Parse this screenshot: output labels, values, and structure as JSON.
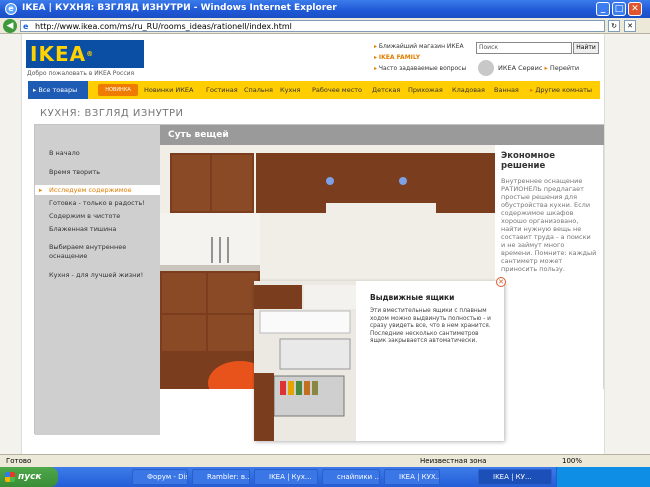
{
  "window": {
    "title": "IKEA | КУХНЯ: ВЗГЛЯД ИЗНУТРИ - Windows Internet Explorer",
    "url": "http://www.ikea.com/ms/ru_RU/rooms_ideas/rationell/index.html"
  },
  "header": {
    "logo": "IKEA",
    "welcome": "Добро пожаловать в ИКЕА Россия",
    "links": [
      "Ближайший магазин ИКЕА",
      "IKEA FAMILY",
      "Часто задаваемые вопросы"
    ],
    "search_placeholder": "Поиск",
    "search_button": "Найти",
    "service": "ИКЕА Сервис",
    "goto": "Перейти"
  },
  "menu": {
    "all": "Все товары",
    "badge": "НОВИНКА",
    "items": [
      "Новинки ИКЕА",
      "Гостиная",
      "Спальня",
      "Кухня",
      "Рабочее место",
      "Детская",
      "Прихожая",
      "Кладовая",
      "Ванная",
      "Другие комнаты"
    ]
  },
  "headline": "КУХНЯ: ВЗГЛЯД ИЗНУТРИ",
  "left_nav": [
    "В начало",
    "Время творить",
    "Исследуем содержимое",
    "Готовка - только в радость!",
    "Содержим в чистоте",
    "Блаженная тишина",
    "Выбираем внутреннее",
    "оснащение",
    "Кухня - для лучшей жизни!"
  ],
  "main_title": "Суть вещей",
  "side": {
    "title": "Экономное решение",
    "text": "Внутреннее оснащение РАТИОНЕЛЬ предлагает простые решения для обустройства кухни. Если содержимое шкафов хорошо организовано, найти нужную вещь не составит труда - а поиски и не займут много времени. Помните: каждый сантиметр может приносить пользу."
  },
  "popup": {
    "title": "Выдвижные ящики",
    "body": "Эти вместительные ящики с плавным ходом можно выдвинуть полностью - и сразу увидеть все, что в нем хранится. Последние несколько сантиметров ящик закрывается автоматически."
  },
  "status": {
    "left": "Готово",
    "zone": "Неизвестная зона",
    "zoom": "100%"
  },
  "taskbar": {
    "start": "пуск",
    "tasks": [
      "Форум - Dis...",
      "Rambler: в...",
      "IKEA | Кух...",
      "снайпики ...",
      "IKEA | КУХ...",
      "IKEA | КУ..."
    ]
  },
  "colors": {
    "ikea_blue": "#0a4fa3",
    "ikea_yellow": "#ffcd00",
    "accent_orange": "#e07d00"
  }
}
